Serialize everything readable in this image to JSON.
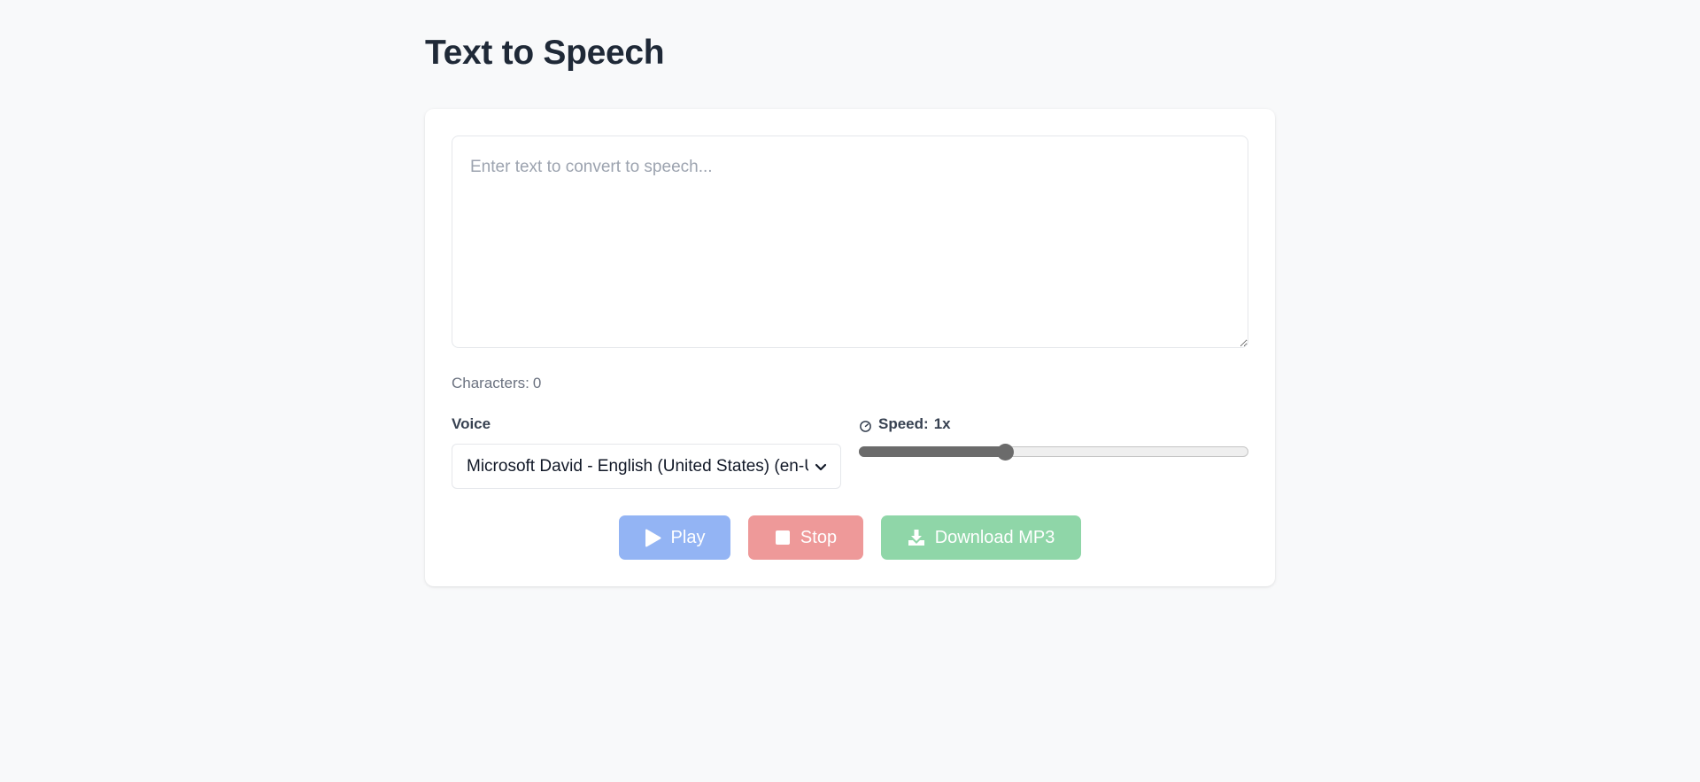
{
  "page": {
    "title": "Text to Speech"
  },
  "editor": {
    "placeholder": "Enter text to convert to speech...",
    "value": ""
  },
  "char_count": {
    "label": "Characters:",
    "value": "0"
  },
  "voice": {
    "label": "Voice",
    "selected": "Microsoft David - English (United States) (en-US)"
  },
  "speed": {
    "label": "Speed:",
    "value_text": "1x",
    "value": 1,
    "min": 0.1,
    "max": 2.5,
    "icon": "gauge-icon"
  },
  "buttons": {
    "play_label": "Play",
    "stop_label": "Stop",
    "download_label": "Download MP3"
  },
  "colors": {
    "play": "#93b4f4",
    "stop": "#ee9999",
    "download": "#8fd6a8",
    "background": "#f8f9fa"
  }
}
